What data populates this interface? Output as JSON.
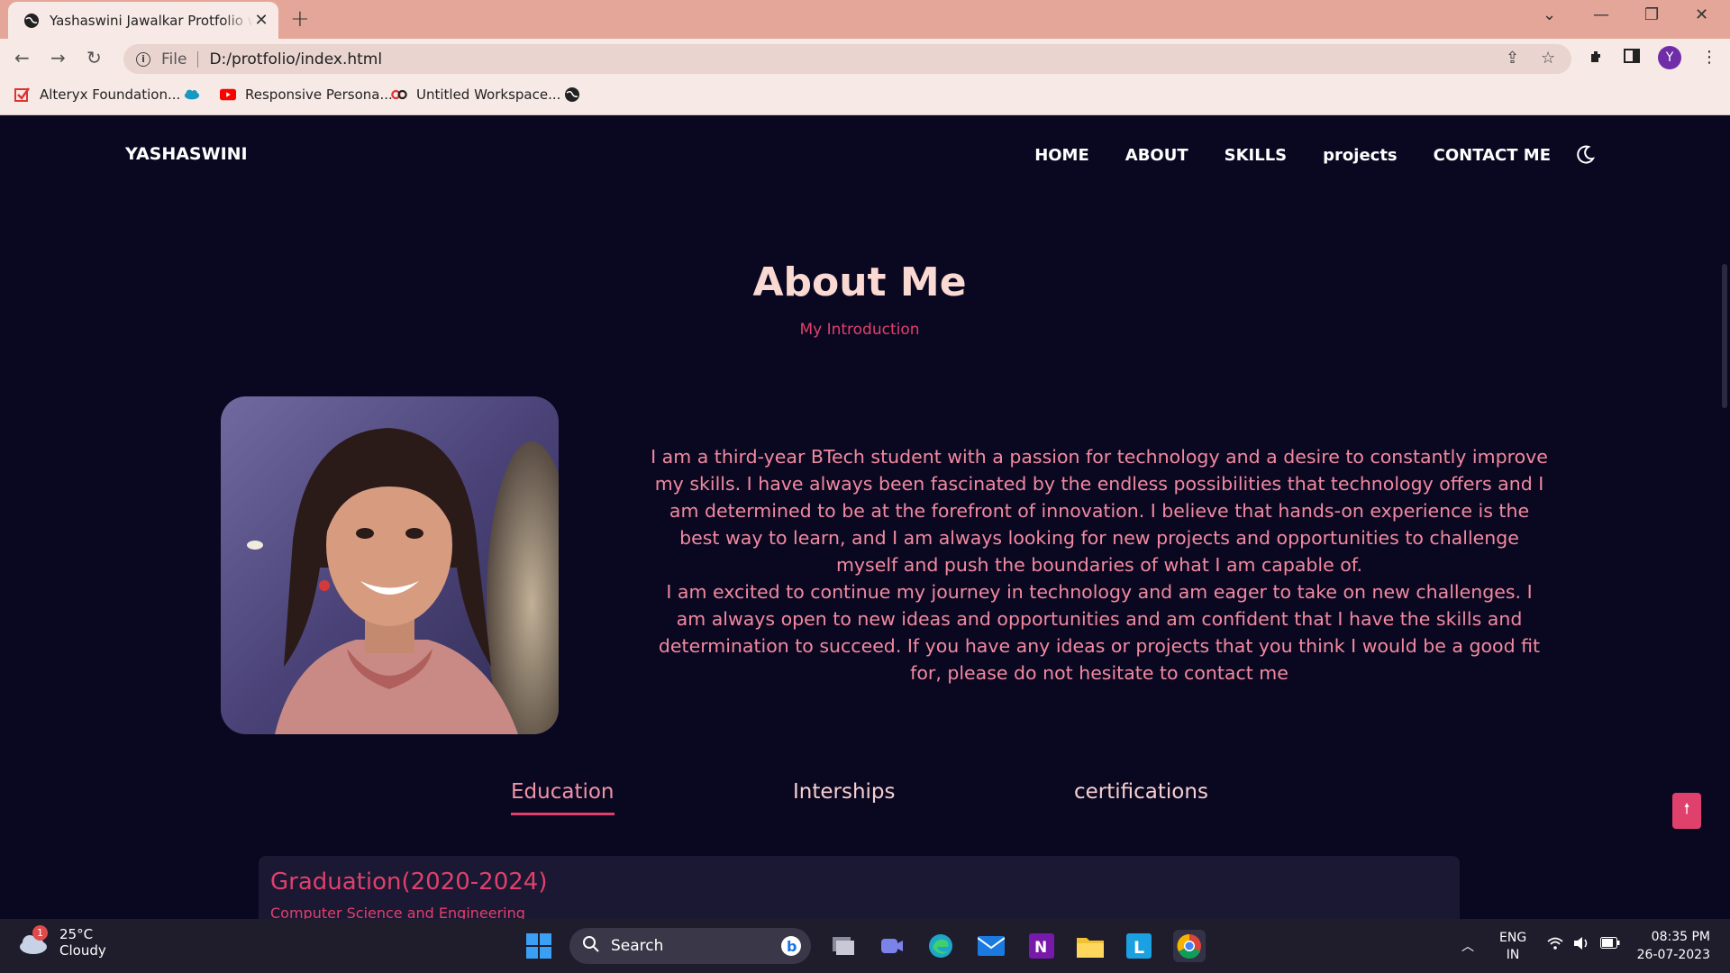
{
  "browser": {
    "tab_title": "Yashaswini Jawalkar Protfolio website",
    "url_scheme": "File",
    "url": "D:/protfolio/index.html",
    "profile_initial": "Y",
    "bookmarks": [
      {
        "label": "Alteryx Foundation..."
      },
      {
        "label": ""
      },
      {
        "label": "Responsive Persona..."
      },
      {
        "label": "Untitled Workspace..."
      },
      {
        "label": ""
      }
    ]
  },
  "site": {
    "logo": "YASHASWINI",
    "nav": [
      "HOME",
      "ABOUT",
      "SKILLS",
      "projects",
      "CONTACT ME"
    ],
    "section_title": "About Me",
    "section_subtitle": "My Introduction",
    "about_paragraph_1": "I am a third-year BTech student with a passion for technology and a desire to constantly improve my skills. I have always been fascinated by the endless possibilities that technology offers and I am determined to be at the forefront of innovation. I believe that hands-on experience is the best way to learn, and I am always looking for new projects and opportunities to challenge myself and push the boundaries of what I am capable of.",
    "about_paragraph_2": "I am excited to continue my journey in technology and am eager to take on new challenges. I am always open to new ideas and opportunities and am confident that I have the skills and determination to succeed. If you have any ideas or projects that you think I would be a good fit for, please do not hesitate to contact me",
    "tabs": [
      "Education",
      "Interships",
      "certifications"
    ],
    "active_tab": "Education",
    "card_title": "Graduation(2020-2024)",
    "card_subtitle": "Computer Science and Engineering"
  },
  "colors": {
    "page_bg": "#0a0820",
    "accent": "#e0406c",
    "text_pink": "#f289a0",
    "title": "#fbd9d3"
  },
  "taskbar": {
    "weather_temp": "25°C",
    "weather_desc": "Cloudy",
    "weather_badge": "1",
    "search_label": "Search",
    "lang_top": "ENG",
    "lang_bottom": "IN",
    "time": "08:35 PM",
    "date": "26-07-2023",
    "pinned_icons": [
      "windows-start-icon",
      "bing-icon",
      "task-view-icon",
      "teams-icon",
      "edge-icon",
      "mail-icon",
      "onenote-icon",
      "file-explorer-icon",
      "linkedin-learning-icon",
      "chrome-icon"
    ]
  }
}
